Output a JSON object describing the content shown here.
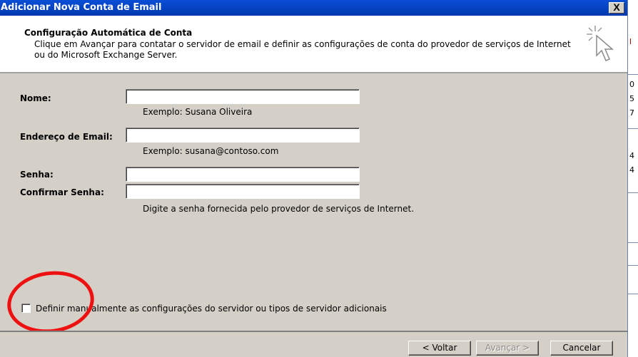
{
  "window": {
    "title": "Adicionar Nova Conta de Email",
    "close_label": "X"
  },
  "header": {
    "title": "Configuração Automática de Conta",
    "description": "Clique em Avançar para contatar o servidor de email e definir as configurações de conta do provedor de serviços de Internet ou do Microsoft Exchange Server."
  },
  "form": {
    "name": {
      "label": "Nome:",
      "value": "",
      "hint": "Exemplo: Susana Oliveira"
    },
    "email": {
      "label": "Endereço de Email:",
      "value": "",
      "hint": "Exemplo: susana@contoso.com"
    },
    "password": {
      "label": "Senha:",
      "value": ""
    },
    "confirm_password": {
      "label": "Confirmar Senha:",
      "value": "",
      "hint": "Digite a senha fornecida pelo provedor de serviços de Internet."
    }
  },
  "manual_config": {
    "label": "Definir manualmente as configurações do servidor ou tipos de servidor adicionais",
    "checked": false
  },
  "buttons": {
    "back": "< Voltar",
    "next": "Avançar >",
    "cancel": "Cancelar"
  },
  "background_app": {
    "glyphs": [
      "l",
      "0",
      "5",
      "7",
      "4",
      "4"
    ]
  },
  "annotation": {
    "color": "#ee1111"
  }
}
